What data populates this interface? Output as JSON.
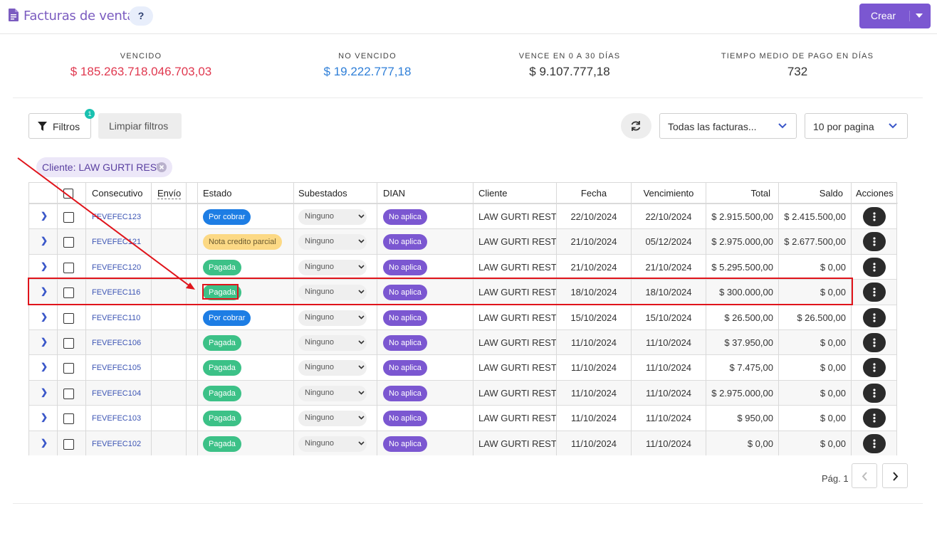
{
  "header": {
    "title": "Facturas de venta",
    "help_label": "?",
    "create_label": "Crear"
  },
  "stats": [
    {
      "label": "VENCIDO",
      "value": "$ 185.263.718.046.703,03",
      "color": "#e0384f"
    },
    {
      "label": "NO VENCIDO",
      "value": "$ 19.222.777,18",
      "color": "#2f7fd8"
    },
    {
      "label": "VENCE EN 0 A 30 DÍAS",
      "value": "$ 9.107.777,18",
      "color": "#333333"
    },
    {
      "label": "TIEMPO MEDIO DE PAGO EN DÍAS",
      "value": "732",
      "color": "#333333"
    }
  ],
  "toolbar": {
    "filters_label": "Filtros",
    "filters_count": "1",
    "clear_label": "Limpiar filtros",
    "invoice_filter": "Todas las facturas...",
    "per_page": "10 por pagina"
  },
  "active_filter": "Cliente: LAW GURTI REST",
  "table": {
    "columns": [
      "Consecutivo",
      "Envío",
      "Estado",
      "Subestados",
      "DIAN",
      "Cliente",
      "Fecha",
      "Vencimiento",
      "Total",
      "Saldo",
      "Acciones"
    ],
    "rows": [
      {
        "consecutivo": "FEVEFEC123",
        "estado": "Por cobrar",
        "subestado": "Ninguno",
        "dian": "No aplica",
        "cliente": "LAW GURTI REST",
        "fecha": "22/10/2024",
        "vencimiento": "22/10/2024",
        "total": "$ 2.915.500,00",
        "saldo": "$ 2.415.500,00"
      },
      {
        "consecutivo": "FEVEFEC121",
        "estado": "Nota credito parcial",
        "subestado": "Ninguno",
        "dian": "No aplica",
        "cliente": "LAW GURTI REST",
        "fecha": "21/10/2024",
        "vencimiento": "05/12/2024",
        "total": "$ 2.975.000,00",
        "saldo": "$ 2.677.500,00"
      },
      {
        "consecutivo": "FEVEFEC120",
        "estado": "Pagada",
        "subestado": "Ninguno",
        "dian": "No aplica",
        "cliente": "LAW GURTI REST",
        "fecha": "21/10/2024",
        "vencimiento": "21/10/2024",
        "total": "$ 5.295.500,00",
        "saldo": "$ 0,00"
      },
      {
        "consecutivo": "FEVEFEC116",
        "estado": "Pagada",
        "subestado": "Ninguno",
        "dian": "No aplica",
        "cliente": "LAW GURTI REST",
        "fecha": "18/10/2024",
        "vencimiento": "18/10/2024",
        "total": "$ 300.000,00",
        "saldo": "$ 0,00"
      },
      {
        "consecutivo": "FEVEFEC110",
        "estado": "Por cobrar",
        "subestado": "Ninguno",
        "dian": "No aplica",
        "cliente": "LAW GURTI REST",
        "fecha": "15/10/2024",
        "vencimiento": "15/10/2024",
        "total": "$ 26.500,00",
        "saldo": "$ 26.500,00"
      },
      {
        "consecutivo": "FEVEFEC106",
        "estado": "Pagada",
        "subestado": "Ninguno",
        "dian": "No aplica",
        "cliente": "LAW GURTI REST",
        "fecha": "11/10/2024",
        "vencimiento": "11/10/2024",
        "total": "$ 37.950,00",
        "saldo": "$ 0,00"
      },
      {
        "consecutivo": "FEVEFEC105",
        "estado": "Pagada",
        "subestado": "Ninguno",
        "dian": "No aplica",
        "cliente": "LAW GURTI REST",
        "fecha": "11/10/2024",
        "vencimiento": "11/10/2024",
        "total": "$ 7.475,00",
        "saldo": "$ 0,00"
      },
      {
        "consecutivo": "FEVEFEC104",
        "estado": "Pagada",
        "subestado": "Ninguno",
        "dian": "No aplica",
        "cliente": "LAW GURTI REST",
        "fecha": "11/10/2024",
        "vencimiento": "11/10/2024",
        "total": "$ 2.975.000,00",
        "saldo": "$ 0,00"
      },
      {
        "consecutivo": "FEVEFEC103",
        "estado": "Pagada",
        "subestado": "Ninguno",
        "dian": "No aplica",
        "cliente": "LAW GURTI REST",
        "fecha": "11/10/2024",
        "vencimiento": "11/10/2024",
        "total": "$ 950,00",
        "saldo": "$ 0,00"
      },
      {
        "consecutivo": "FEVEFEC102",
        "estado": "Pagada",
        "subestado": "Ninguno",
        "dian": "No aplica",
        "cliente": "LAW GURTI REST",
        "fecha": "11/10/2024",
        "vencimiento": "11/10/2024",
        "total": "$ 0,00",
        "saldo": "$ 0,00"
      }
    ]
  },
  "pagination": {
    "label": "Pág. 1"
  },
  "colors": {
    "accent": "#7b57d1",
    "highlight": "#e0141b",
    "por_cobrar": "#1d7de4",
    "pagada": "#3cc187",
    "nota": "#fcd985"
  },
  "icons": [
    "file-text-icon",
    "filter-icon",
    "refresh-icon",
    "chevron-down-icon",
    "chevron-right-icon",
    "chevron-left-icon",
    "close-circle-icon",
    "more-vertical-icon"
  ]
}
